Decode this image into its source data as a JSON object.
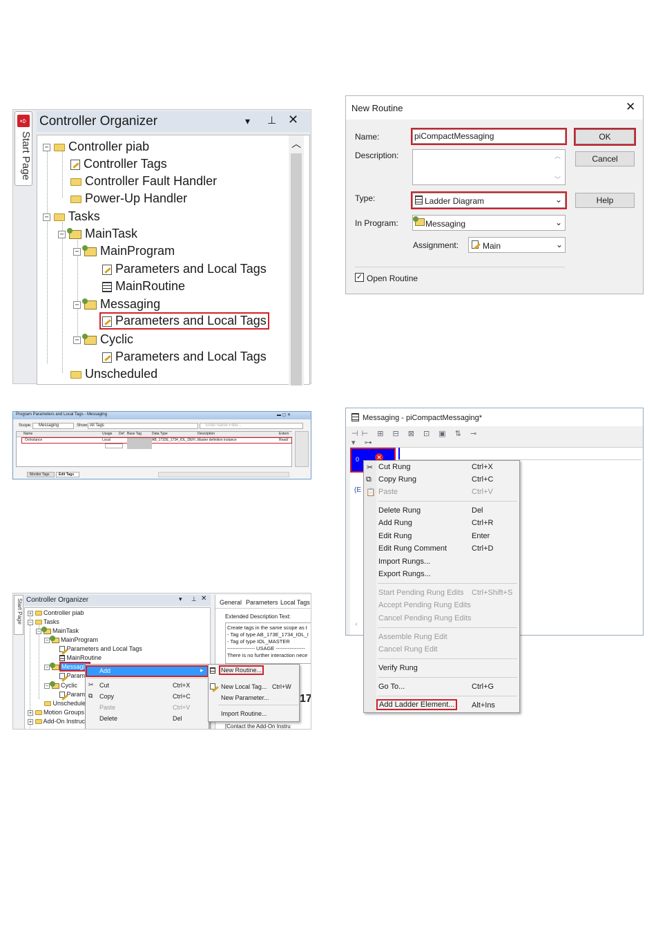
{
  "panel1": {
    "side_tab": "Start Page",
    "title": "Controller Organizer",
    "tree": [
      {
        "label": "Controller piab"
      },
      {
        "label": "Controller Tags"
      },
      {
        "label": "Controller Fault Handler"
      },
      {
        "label": "Power-Up Handler"
      },
      {
        "label": "Tasks"
      },
      {
        "label": "MainTask"
      },
      {
        "label": "MainProgram"
      },
      {
        "label": "Parameters and Local Tags"
      },
      {
        "label": "MainRoutine"
      },
      {
        "label": "Messaging"
      },
      {
        "label": "Parameters and Local Tags"
      },
      {
        "label": "Cyclic"
      },
      {
        "label": "Parameters and Local Tags"
      },
      {
        "label": "Unscheduled"
      }
    ]
  },
  "dialog": {
    "title": "New Routine",
    "name_label": "Name:",
    "name_value": "piCompactMessaging",
    "description_label": "Description:",
    "type_label": "Type:",
    "type_value": "Ladder Diagram",
    "program_label": "In Program:",
    "program_value": "Messaging",
    "assignment_label": "Assignment:",
    "assignment_value": "Main",
    "ok": "OK",
    "cancel": "Cancel",
    "help": "Help",
    "open_routine": "Open Routine"
  },
  "tags_window": {
    "title": "Program Parameters and Local Tags - Messaging",
    "scope_label": "Scope:",
    "scope_value": "Messaging",
    "show_label": "Show:",
    "show_value": "All Tags",
    "filter_placeholder": "Enter Name Filter...",
    "columns": [
      "Name",
      "Usage",
      "Def",
      "Base Tag",
      "Data Type",
      "Description",
      "Extern",
      "A..."
    ],
    "row": {
      "name": "OvInstance",
      "usage": "Local",
      "datatype": "AB_1732E_1734_IOL_DEFI...",
      "description": "Master definition instance",
      "extern": "Read/"
    },
    "tab_monitor": "Monitor Tags",
    "tab_edit": "Edit Tags"
  },
  "panel3": {
    "side_tab": "Start Page",
    "title": "Controller Organizer",
    "tree": [
      {
        "label": "Controller piab"
      },
      {
        "label": "Tasks"
      },
      {
        "label": "MainTask"
      },
      {
        "label": "MainProgram"
      },
      {
        "label": "Parameters and Local Tags"
      },
      {
        "label": "MainRoutine"
      },
      {
        "label": "Messagin"
      },
      {
        "label": "Param"
      },
      {
        "label": "Cyclic"
      },
      {
        "label": "Param"
      },
      {
        "label": "Unscheduled"
      },
      {
        "label": "Motion Groups"
      },
      {
        "label": "Add-On Instruc"
      }
    ],
    "context_menu": [
      {
        "label": "Add",
        "shortcut": ""
      },
      {
        "label": "Cut",
        "shortcut": "Ctrl+X"
      },
      {
        "label": "Copy",
        "shortcut": "Ctrl+C"
      },
      {
        "label": "Paste",
        "shortcut": "Ctrl+V"
      },
      {
        "label": "Delete",
        "shortcut": "Del"
      }
    ],
    "submenu": [
      {
        "label": "New Routine...",
        "shortcut": ""
      },
      {
        "label": "New Local Tag...",
        "shortcut": "Ctrl+W"
      },
      {
        "label": "New Parameter...",
        "shortcut": ""
      },
      {
        "label": "Import Routine...",
        "shortcut": ""
      }
    ],
    "right_tabs": [
      "General",
      "Parameters",
      "Local Tags"
    ],
    "ext_desc_label": "Extended Description Text:",
    "ext_desc_lines": [
      "Create tags in the same scope as t",
      "- Tag of type AB_173E_1734_IOL_I",
      "- Tag of type IOL_MASTER",
      "---------------- USAGE -----------------",
      "There is no further interaction nece"
    ],
    "big_text": "17",
    "footer_text": "[Contact the Add-On Instru"
  },
  "panel4": {
    "title": "Messaging - piCompactMessaging*",
    "rung_number": "0",
    "side_text": "(E",
    "menu": [
      {
        "label": "Cut Rung",
        "shortcut": "Ctrl+X",
        "enabled": true
      },
      {
        "label": "Copy Rung",
        "shortcut": "Ctrl+C",
        "enabled": true
      },
      {
        "label": "Paste",
        "shortcut": "Ctrl+V",
        "enabled": false
      },
      {
        "label": "Delete Rung",
        "shortcut": "Del",
        "enabled": true
      },
      {
        "label": "Add Rung",
        "shortcut": "Ctrl+R",
        "enabled": true
      },
      {
        "label": "Edit Rung",
        "shortcut": "Enter",
        "enabled": true
      },
      {
        "label": "Edit Rung Comment",
        "shortcut": "Ctrl+D",
        "enabled": true
      },
      {
        "label": "Import Rungs...",
        "shortcut": "",
        "enabled": true
      },
      {
        "label": "Export Rungs...",
        "shortcut": "",
        "enabled": true
      },
      {
        "label": "Start Pending Rung Edits",
        "shortcut": "Ctrl+Shift+S",
        "enabled": false
      },
      {
        "label": "Accept Pending Rung Edits",
        "shortcut": "",
        "enabled": false
      },
      {
        "label": "Cancel Pending Rung Edits",
        "shortcut": "",
        "enabled": false
      },
      {
        "label": "Assemble Rung Edit",
        "shortcut": "",
        "enabled": false
      },
      {
        "label": "Cancel Rung Edit",
        "shortcut": "",
        "enabled": false
      },
      {
        "label": "Verify Rung",
        "shortcut": "",
        "enabled": true
      },
      {
        "label": "Go To...",
        "shortcut": "Ctrl+G",
        "enabled": true
      },
      {
        "label": "Add Ladder Element...",
        "shortcut": "Alt+Ins",
        "enabled": true
      }
    ]
  },
  "colors": {
    "highlight_red": "#d0202a",
    "selection_blue": "#3399ff",
    "rung_blue": "#0000ff"
  }
}
